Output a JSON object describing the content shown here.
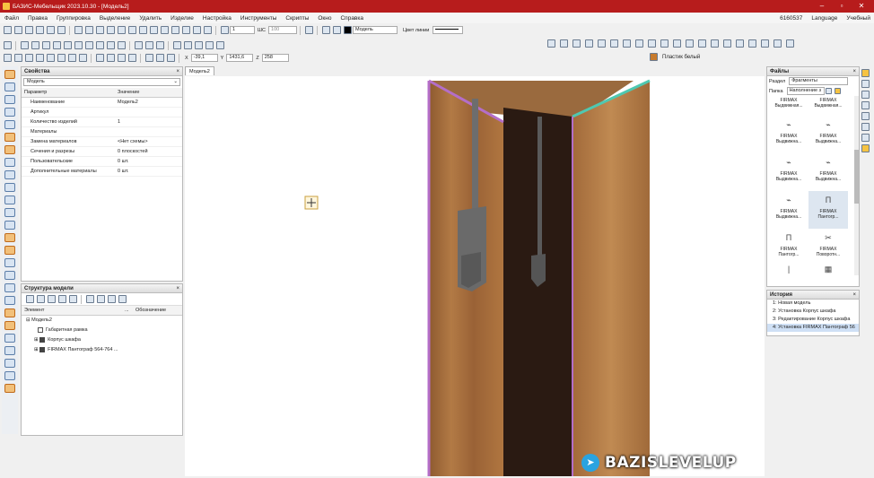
{
  "window": {
    "title": "БАЗИС-Мебельщик 2023.10.30 - [Модель2]"
  },
  "menu": [
    "Файл",
    "Правка",
    "Группировка",
    "Выделение",
    "Удалить",
    "Изделие",
    "Настройка",
    "Инструменты",
    "Скрипты",
    "Окно",
    "Справка"
  ],
  "menu_right": {
    "code": "6160537",
    "language": "Language",
    "mode": "Учебный"
  },
  "toolbar": {
    "layer_num": "1",
    "sh_label": "ШС",
    "sh_value": "100",
    "model_label": "Модель",
    "line_color_label": "Цвет линии",
    "material": "Пластик белый"
  },
  "coords": {
    "x_label": "X",
    "x": "-39,1",
    "y_label": "Y",
    "y": "1431,6",
    "z_label": "Z",
    "z": "258"
  },
  "properties": {
    "title": "Свойства",
    "selector": "Модель",
    "col_param": "Параметр",
    "col_value": "Значение",
    "rows": [
      {
        "param": "Наименование",
        "value": "Модель2"
      },
      {
        "param": "Артикул",
        "value": ""
      },
      {
        "param": "Количество изделий",
        "value": "1"
      },
      {
        "param": "Материалы",
        "value": ""
      },
      {
        "param": "Замена материалов",
        "value": "<Нет схемы>"
      },
      {
        "param": "Сечения и разрезы",
        "value": "0 плоскостей"
      },
      {
        "param": "Пользовательские",
        "value": "0 шт."
      },
      {
        "param": "Дополнительные материалы",
        "value": "0 шт."
      }
    ]
  },
  "structure": {
    "title": "Структура модели",
    "col_element": "Элемент",
    "col_dots": "...",
    "col_designation": "Обозначение",
    "root": "Модель2",
    "items": [
      "Габаритная рамка",
      "Корпус шкафа",
      "FIRMAX Пантограф 564-764 ..."
    ]
  },
  "viewport": {
    "tab": "Модель2"
  },
  "files": {
    "title": "Файлы",
    "section_label": "Раздел",
    "section_value": "Фрагменты",
    "folder_label": "Папка",
    "folder_value": "Наполнение з",
    "items": [
      {
        "l1": "FIRMAX",
        "l2": "Выдвижная..."
      },
      {
        "l1": "FIRMAX",
        "l2": "Выдвижная..."
      },
      {
        "l1": "FIRMAX",
        "l2": "Выдвижна..."
      },
      {
        "l1": "FIRMAX",
        "l2": "Выдвижна..."
      },
      {
        "l1": "FIRMAX",
        "l2": "Выдвижна..."
      },
      {
        "l1": "FIRMAX",
        "l2": "Выдвижна..."
      },
      {
        "l1": "FIRMAX",
        "l2": "Выдвижна..."
      },
      {
        "l1": "FIRMAX",
        "l2": "Пантогр..."
      },
      {
        "l1": "FIRMAX",
        "l2": "Пантогр..."
      },
      {
        "l1": "FIRMAX",
        "l2": "Поворотн..."
      }
    ]
  },
  "history": {
    "title": "История",
    "items": [
      "1: Новая модель",
      "2: Установка Корпус шкафа",
      "3: Редактирование Корпус шкафа",
      "4: Установка FIRMAX Пантограф 56"
    ]
  },
  "watermark": {
    "text": "BAZISLEVELUP"
  },
  "colors": {
    "titlebar": "#b71c1c",
    "wood": "#a0683a",
    "dark_wood": "#2a1a12",
    "edge_purple": "#b46ec8",
    "edge_teal": "#4fc8b0"
  }
}
